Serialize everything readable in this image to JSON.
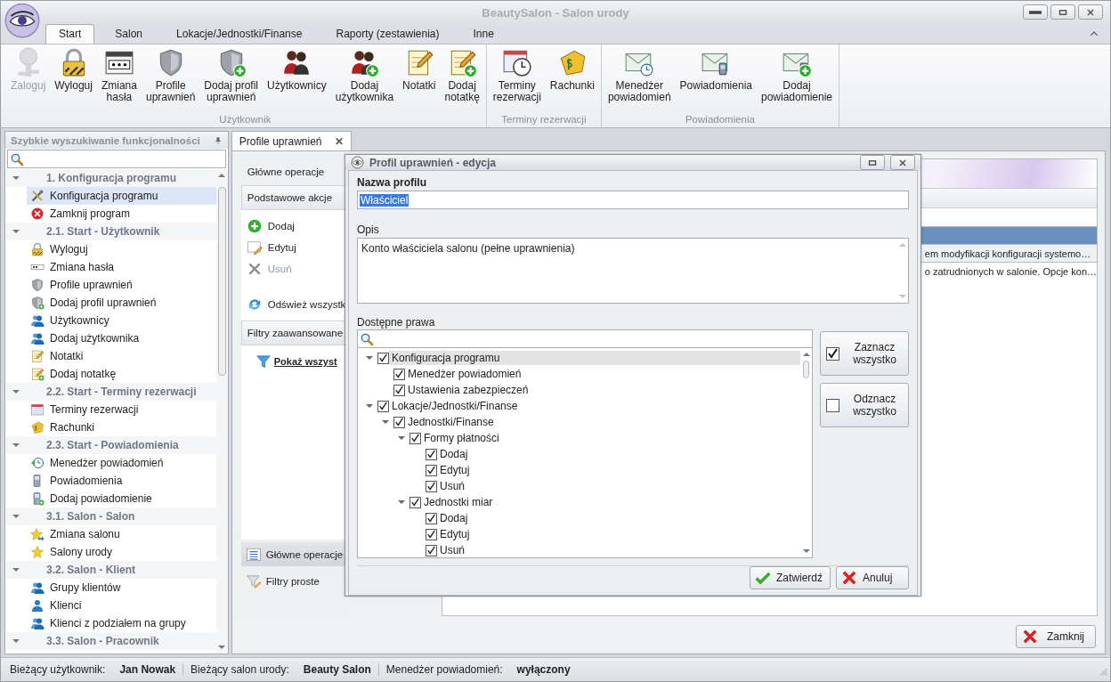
{
  "window": {
    "title": "BeautySalon - Salon urody"
  },
  "ribbon": {
    "tabs": [
      {
        "label": "Start",
        "selected": true
      },
      {
        "label": "Salon",
        "selected": false
      },
      {
        "label": "Lokacje/Jednostki/Finanse",
        "selected": false
      },
      {
        "label": "Raporty (zestawienia)",
        "selected": false
      },
      {
        "label": "Inne",
        "selected": false
      }
    ],
    "groups": [
      {
        "label": "Użytkownik",
        "buttons": [
          {
            "label": "Zaloguj",
            "disabled": true
          },
          {
            "label": "Wyloguj",
            "disabled": false
          },
          {
            "label": "Zmiana\nhasła",
            "disabled": false
          },
          {
            "label": "Profile\nuprawnień",
            "disabled": false
          },
          {
            "label": "Dodaj profil\nuprawnień",
            "disabled": false
          },
          {
            "label": "Użytkownicy",
            "disabled": false
          },
          {
            "label": "Dodaj\nużytkownika",
            "disabled": false
          },
          {
            "label": "Notatki",
            "disabled": false
          },
          {
            "label": "Dodaj\nnotatkę",
            "disabled": false
          }
        ]
      },
      {
        "label": "Terminy rezerwacji",
        "buttons": [
          {
            "label": "Terminy\nrezerwacji",
            "disabled": false
          },
          {
            "label": "Rachunki",
            "disabled": false
          }
        ]
      },
      {
        "label": "Powiadomienia",
        "buttons": [
          {
            "label": "Menedżer\npowiadomień",
            "disabled": false
          },
          {
            "label": "Powiadomienia",
            "disabled": false
          },
          {
            "label": "Dodaj\npowiadomienie",
            "disabled": false
          }
        ]
      }
    ]
  },
  "quick_search": {
    "title": "Szybkie wyszukiwanie funkcjonalności",
    "groups": [
      {
        "label": "1. Konfiguracja programu",
        "expanded": true,
        "items": [
          {
            "label": "Konfiguracja programu",
            "selected": true
          },
          {
            "label": "Zamknij program",
            "selected": false
          }
        ]
      },
      {
        "label": "2.1. Start - Użytkownik",
        "expanded": true,
        "items": [
          {
            "label": "Wyloguj",
            "selected": false
          },
          {
            "label": "Zmiana hasła",
            "selected": false
          },
          {
            "label": "Profile uprawnień",
            "selected": false
          },
          {
            "label": "Dodaj profil uprawnień",
            "selected": false
          },
          {
            "label": "Użytkownicy",
            "selected": false
          },
          {
            "label": "Dodaj użytkownika",
            "selected": false
          },
          {
            "label": "Notatki",
            "selected": false
          },
          {
            "label": "Dodaj notatkę",
            "selected": false
          }
        ]
      },
      {
        "label": "2.2. Start - Terminy rezerwacji",
        "expanded": true,
        "items": [
          {
            "label": "Terminy rezerwacji",
            "selected": false
          },
          {
            "label": "Rachunki",
            "selected": false
          }
        ]
      },
      {
        "label": "2.3. Start - Powiadomienia",
        "expanded": true,
        "items": [
          {
            "label": "Menedżer powiadomień",
            "selected": false
          },
          {
            "label": "Powiadomienia",
            "selected": false
          },
          {
            "label": "Dodaj powiadomienie",
            "selected": false
          }
        ]
      },
      {
        "label": "3.1. Salon - Salon",
        "expanded": true,
        "items": [
          {
            "label": "Zmiana salonu",
            "selected": false
          },
          {
            "label": "Salony urody",
            "selected": false
          }
        ]
      },
      {
        "label": "3.2. Salon - Klient",
        "expanded": true,
        "items": [
          {
            "label": "Grupy klientów",
            "selected": false
          },
          {
            "label": "Klienci",
            "selected": false
          },
          {
            "label": "Klienci z podziałem na grupy",
            "selected": false
          }
        ]
      },
      {
        "label": "3.3. Salon - Pracownik",
        "expanded": true
      }
    ]
  },
  "document_tab": {
    "label": "Profile uprawnień",
    "close": "✕"
  },
  "side_nav": {
    "title": "Główne operacje",
    "sections": [
      {
        "label": "Podstawowe akcje",
        "actions": [
          {
            "label": "Dodaj",
            "disabled": false
          },
          {
            "label": "Edytuj",
            "disabled": false
          },
          {
            "label": "Usuń",
            "disabled": true
          },
          {
            "label": "Odśwież wszystk",
            "disabled": false
          }
        ]
      },
      {
        "label": "Filtry zaawansowane",
        "actions": [
          {
            "label": "Pokaż wszyst",
            "disabled": false
          }
        ]
      }
    ],
    "bottom": [
      {
        "label": "Główne operacje",
        "selected": true
      },
      {
        "label": "Filtry proste",
        "selected": false
      }
    ]
  },
  "grid": {
    "rows": [
      {
        "selected": true
      },
      {
        "cell": "em modyfikacji konfiguracji systemo…",
        "selected": false
      },
      {
        "cell": "o zatrudnionych w salonie. Opcje kon…",
        "selected": false
      }
    ]
  },
  "close_button": "Zamknij",
  "dialog": {
    "title": "Profil uprawnień - edycja",
    "name_label": "Nazwa profilu",
    "name_value": "Właściciel",
    "description_label": "Opis",
    "description_value": "Konto właściciela salonu (pełne uprawnienia)",
    "rights_label": "Dostępne prawa",
    "rights": [
      {
        "label": "Konfiguracja programu",
        "checked": true,
        "selected": true,
        "expanded": true,
        "children": [
          {
            "label": "Menedżer powiadomień",
            "checked": true,
            "selected": false
          },
          {
            "label": "Ustawienia zabezpieczeń",
            "checked": true,
            "selected": false
          }
        ]
      },
      {
        "label": "Lokacje/Jednostki/Finanse",
        "checked": true,
        "selected": false,
        "expanded": true,
        "children": [
          {
            "label": "Jednostki/Finanse",
            "checked": true,
            "selected": false,
            "expanded": true,
            "children": [
              {
                "label": "Formy płatności",
                "checked": true,
                "selected": false,
                "expanded": true,
                "children": [
                  {
                    "label": "Dodaj",
                    "checked": true,
                    "selected": false
                  },
                  {
                    "label": "Edytuj",
                    "checked": true,
                    "selected": false
                  },
                  {
                    "label": "Usuń",
                    "checked": true,
                    "selected": false
                  }
                ]
              },
              {
                "label": "Jednostki miar",
                "checked": true,
                "selected": false,
                "expanded": true,
                "children": [
                  {
                    "label": "Dodaj",
                    "checked": true,
                    "selected": false
                  },
                  {
                    "label": "Edytuj",
                    "checked": true,
                    "selected": false
                  },
                  {
                    "label": "Usuń",
                    "checked": true,
                    "selected": false
                  }
                ]
              }
            ]
          }
        ]
      }
    ],
    "side_buttons": [
      {
        "label": "Zaznacz\nwszystko",
        "checked": true
      },
      {
        "label": "Odznacz\nwszystko",
        "checked": false
      }
    ],
    "buttons": [
      {
        "label": "Zatwierdź",
        "kind": "ok"
      },
      {
        "label": "Anuluj",
        "kind": "cancel"
      }
    ]
  },
  "status_bar": [
    {
      "label": "Bieżący użytkownik:",
      "value": "Jan Nowak"
    },
    {
      "label": "Bieżący salon urody:",
      "value": "Beauty Salon"
    },
    {
      "label": "Menedżer powiadomień:",
      "value": "wyłączony"
    }
  ]
}
